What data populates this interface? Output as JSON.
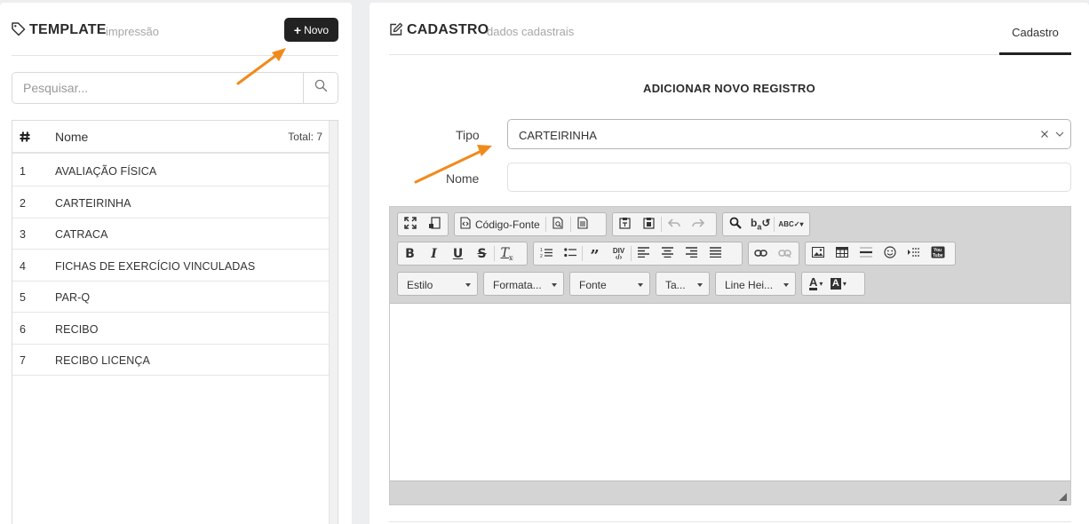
{
  "left_panel": {
    "title": "TEMPLATE",
    "subtitle": "impressão",
    "title_icon": "tag-icon",
    "new_button_label": "Novo",
    "search": {
      "placeholder": "Pesquisar...",
      "value": "",
      "icon": "search-icon"
    },
    "table": {
      "col_num_icon": "hash-icon",
      "col_name": "Nome",
      "total_label": "Total: 7",
      "rows": [
        {
          "num": "1",
          "name": "AVALIAÇÃO FÍSICA"
        },
        {
          "num": "2",
          "name": "CARTEIRINHA"
        },
        {
          "num": "3",
          "name": "CATRACA"
        },
        {
          "num": "4",
          "name": "FICHAS DE EXERCÍCIO VINCULADAS"
        },
        {
          "num": "5",
          "name": "PAR-Q"
        },
        {
          "num": "6",
          "name": "RECIBO"
        },
        {
          "num": "7",
          "name": "RECIBO LICENÇA"
        }
      ]
    }
  },
  "right_panel": {
    "title": "CADASTRO",
    "subtitle": "dados cadastrais",
    "title_icon": "edit-icon",
    "tab_label": "Cadastro",
    "form_title": "ADICIONAR NOVO REGISTRO",
    "tipo_label": "Tipo",
    "tipo_value": "CARTEIRINHA",
    "nome_label": "Nome",
    "nome_value": "",
    "editor": {
      "source_label": "Código-Fonte",
      "combos": {
        "style": "Estilo",
        "format": "Formata...",
        "font": "Fonte",
        "size": "Ta...",
        "line_height": "Line Hei..."
      },
      "text_color_glyph": "A",
      "bg_color_glyph": "A"
    }
  },
  "colors": {
    "accent_arrow": "#f08a1d",
    "button_dark": "#222222",
    "background": "#eceef0"
  }
}
